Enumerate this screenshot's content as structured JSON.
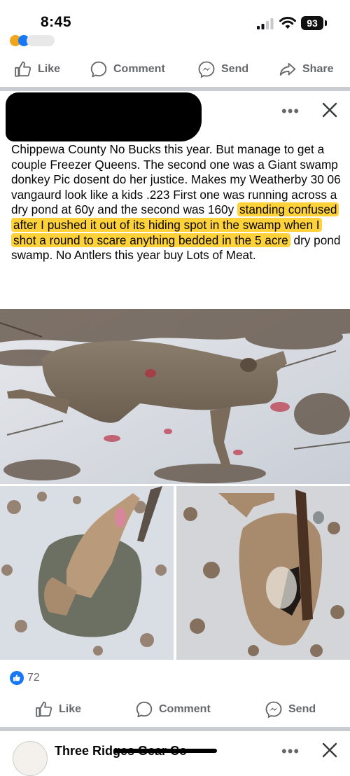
{
  "status_bar": {
    "time": "8:45",
    "battery": "93"
  },
  "prev_post": {
    "actions": {
      "like": "Like",
      "comment": "Comment",
      "send": "Send",
      "share": "Share"
    }
  },
  "post": {
    "text_plain": "Chippewa County No Bucks this year. But manage to get a couple Freezer Queens. The second one was a Giant swamp donkey Pic dosent do her justice. Makes my Weatherby 30 06 vangaurd look like a kids .223 First one was running across a dry pond at 60y and the second was 160y ",
    "text_highlighted": "standing confused after I pushed it out of its hiding spot in the swamp when I shot a round to scare anything bedded in the 5 acre",
    "text_tail": " dry pond swamp. No Antlers this year buy Lots of Meat.",
    "likes_count": "72",
    "actions": {
      "like": "Like",
      "comment": "Comment",
      "send": "Send"
    }
  },
  "next_post": {
    "author": "Three Ridges Gear Co"
  },
  "colors": {
    "accent": "#1877f2",
    "highlight": "#ffd23a",
    "divider": "#c9ccd1",
    "muted": "#65676b"
  },
  "icons": [
    "signal-icon",
    "wifi-icon",
    "battery-icon",
    "like-icon",
    "comment-icon",
    "messenger-icon",
    "share-icon",
    "more-icon",
    "close-icon"
  ]
}
